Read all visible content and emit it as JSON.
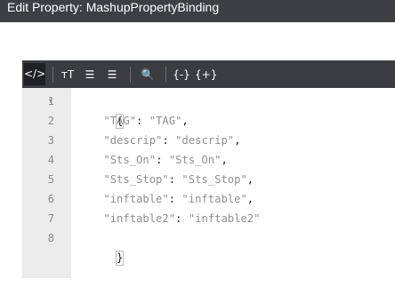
{
  "window": {
    "title": "Edit Property: MashupPropertyBinding"
  },
  "toolbar": {
    "buttons": [
      {
        "name": "code-view-button",
        "icon": "code-icon",
        "glyph": "</>"
      },
      {
        "name": "text-size-button",
        "icon": "text-size-icon",
        "glyph": "тТ"
      },
      {
        "name": "indent-button",
        "icon": "indent-icon",
        "glyph": "☰"
      },
      {
        "name": "outdent-button",
        "icon": "outdent-icon",
        "glyph": "☰"
      },
      {
        "name": "search-button",
        "icon": "search-icon",
        "glyph": "🔍"
      },
      {
        "name": "format-button",
        "icon": "format-braces-icon",
        "glyph": "{-}"
      },
      {
        "name": "compact-button",
        "icon": "compact-braces-icon",
        "glyph": "{+}"
      }
    ]
  },
  "editor": {
    "line_numbers": [
      "1",
      "2",
      "3",
      "4",
      "5",
      "6",
      "7",
      "8"
    ],
    "fold_marker": "▾",
    "open_brace": "{",
    "close_brace": "}",
    "entries": [
      {
        "key": "\"TAG\"",
        "value": "\"TAG\"",
        "comma": ","
      },
      {
        "key": "\"descrip\"",
        "value": "\"descrip\"",
        "comma": ","
      },
      {
        "key": "\"Sts_On\"",
        "value": "\"Sts_On\"",
        "comma": ","
      },
      {
        "key": "\"Sts_Stop\"",
        "value": "\"Sts_Stop\"",
        "comma": ","
      },
      {
        "key": "\"inftable\"",
        "value": "\"inftable\"",
        "comma": ","
      },
      {
        "key": "\"inftable2\"",
        "value": "\"inftable2\"",
        "comma": ""
      }
    ]
  }
}
